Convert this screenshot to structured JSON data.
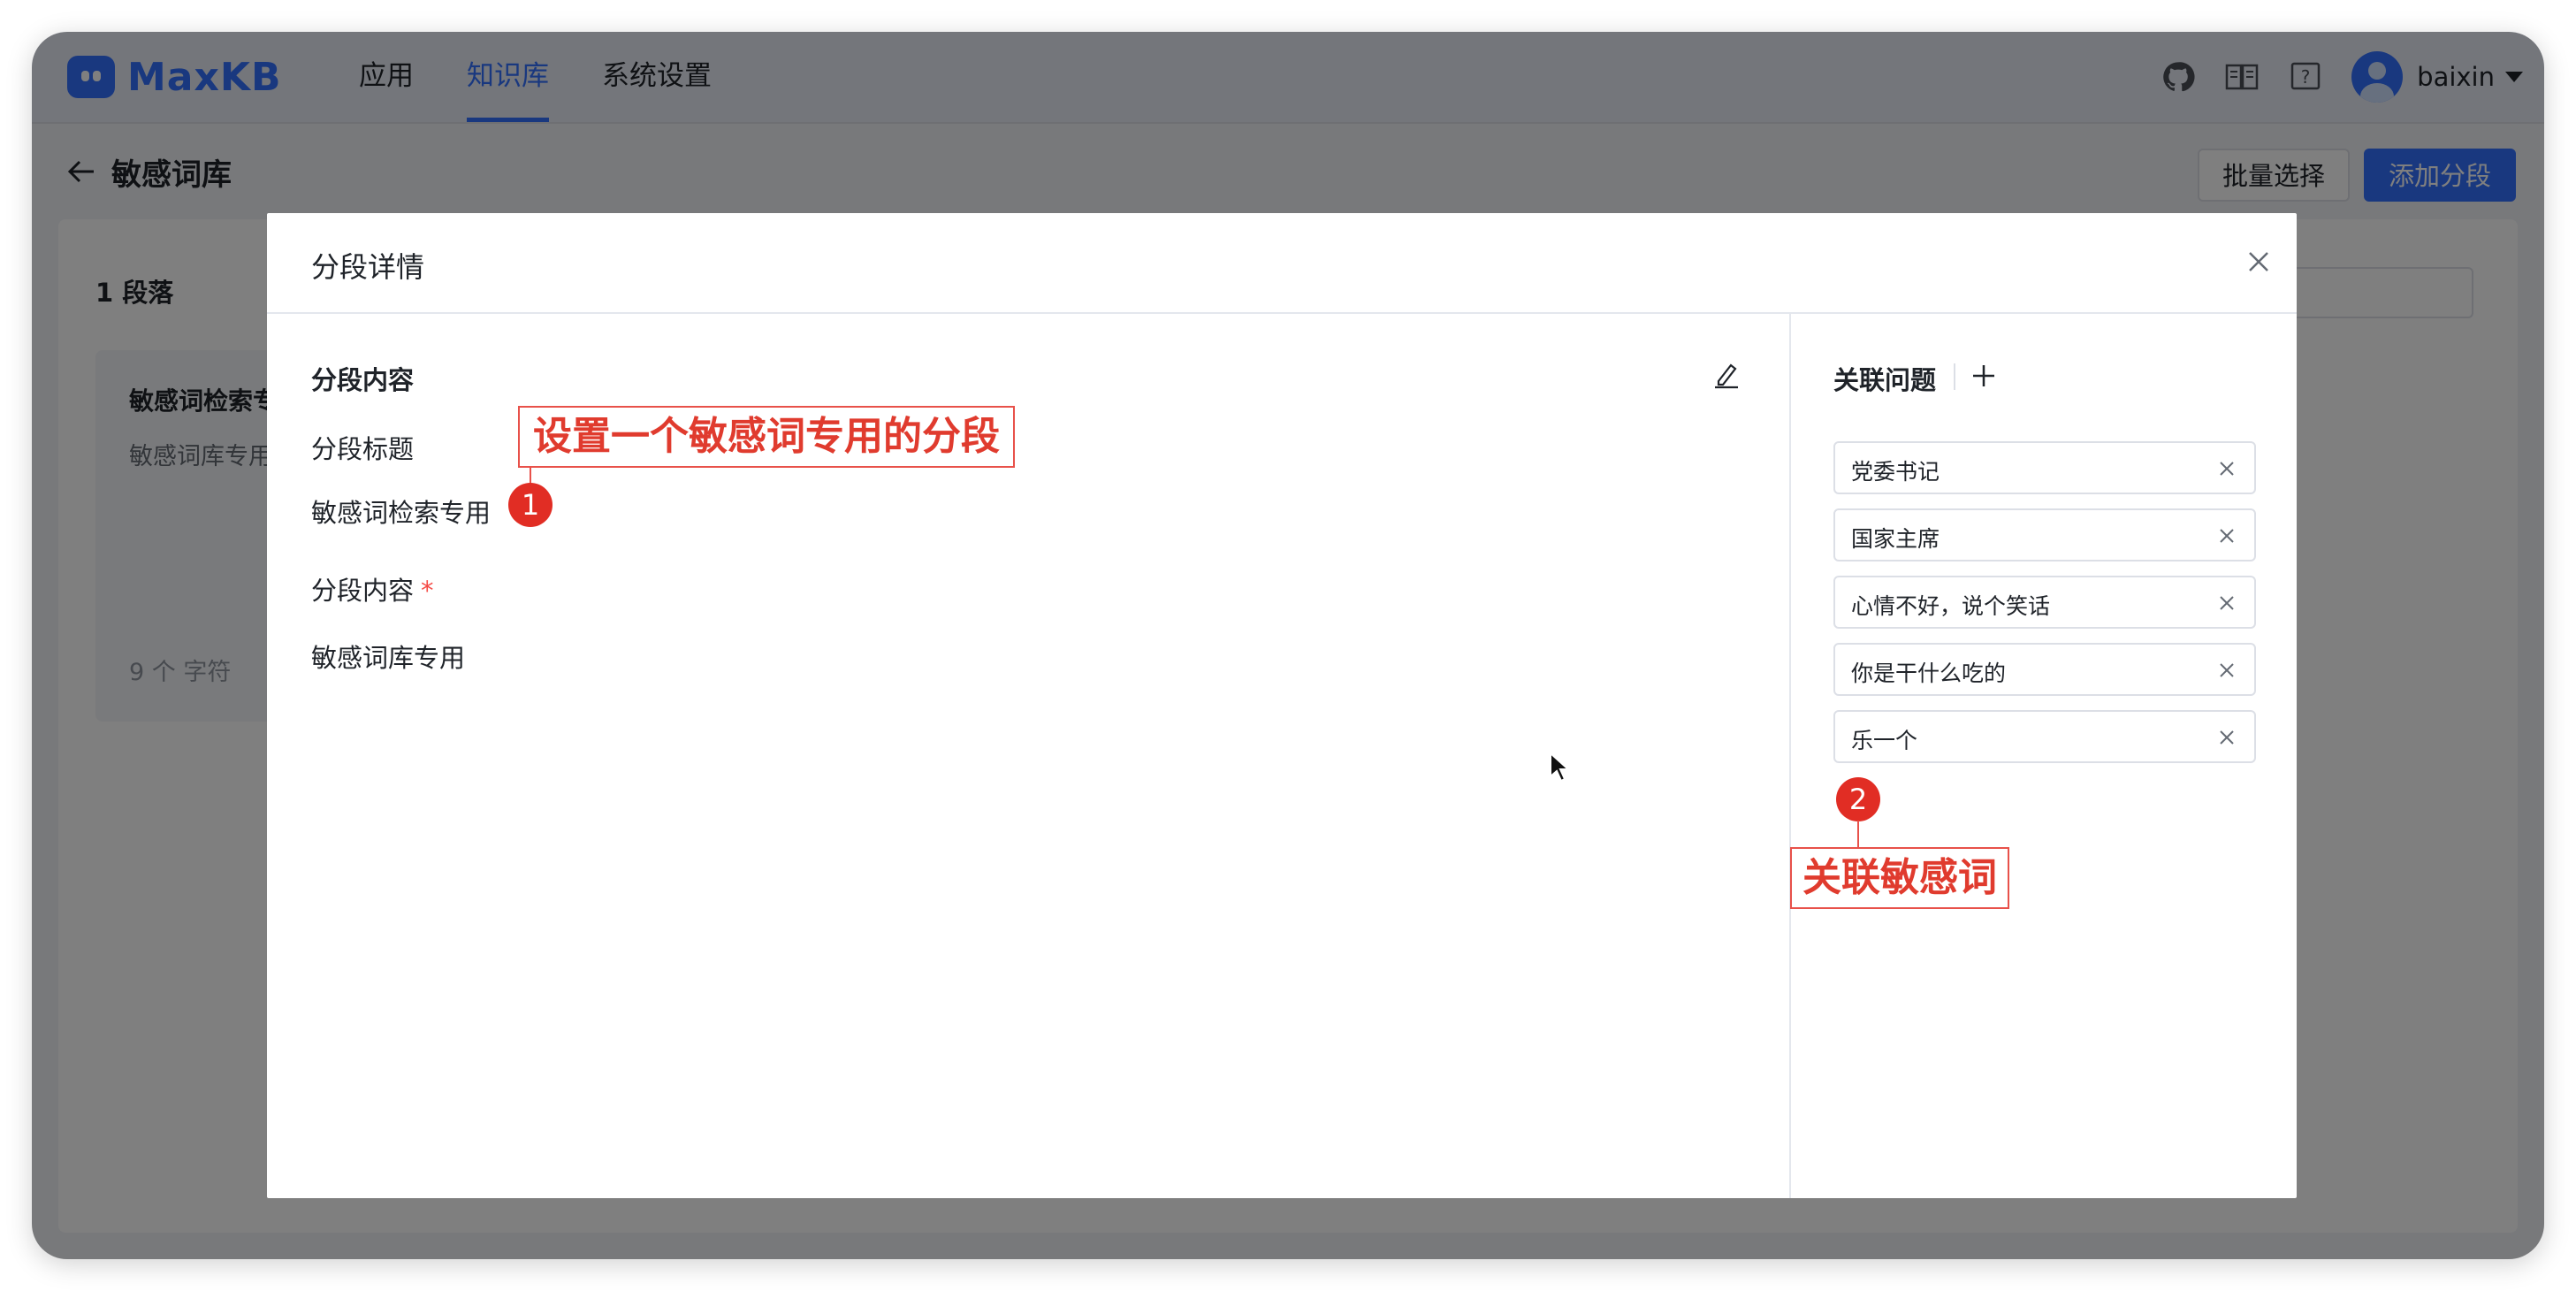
{
  "app": {
    "brand": "MaxKB",
    "nav": [
      "应用",
      "知识库",
      "系统设置"
    ],
    "active_nav": "知识库",
    "user": {
      "name": "baixin"
    },
    "icons": [
      "github-icon",
      "docs-icon",
      "help-icon",
      "avatar",
      "chevron-down-icon"
    ]
  },
  "page": {
    "title": "敏感词库",
    "batch_button": "批量选择",
    "add_button": "添加分段",
    "paragraph_count": "1 段落",
    "segment_card": {
      "title": "敏感词检索专",
      "body": "敏感词库专用",
      "chars": "9 个 字符"
    }
  },
  "dialog": {
    "title": "分段详情",
    "section_title": "分段内容",
    "title_label": "分段标题",
    "title_value": "敏感词检索专用",
    "content_label": "分段内容",
    "required_mark": "*",
    "content_value": "敏感词库专用",
    "related": {
      "title": "关联问题",
      "questions": [
        "党委书记",
        "国家主席",
        "心情不好，说个笑话",
        "你是干什么吃的",
        "乐一个"
      ]
    }
  },
  "annotations": {
    "note1": "设置一个敏感词专用的分段",
    "badge1": "1",
    "note2": "关联敏感词",
    "badge2": "2"
  },
  "colors": {
    "accent": "#3370ff",
    "annotation": "#e12d24",
    "text": "#1f2329"
  }
}
